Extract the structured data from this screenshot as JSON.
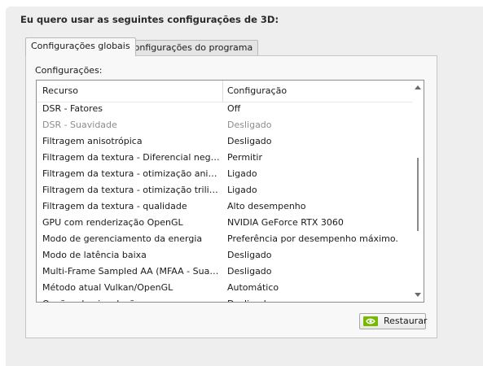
{
  "heading": "Eu quero usar as seguintes configurações de 3D:",
  "tabs": [
    {
      "label": "Configurações globais",
      "active": true
    },
    {
      "label": "Configurações do programa",
      "active": false
    }
  ],
  "settings_label": "Configurações:",
  "table": {
    "columns": [
      "Recurso",
      "Configuração"
    ],
    "rows": [
      {
        "feature": "DSR - Fatores",
        "value": "Off",
        "enabled": true
      },
      {
        "feature": "DSR - Suavidade",
        "value": "Desligado",
        "enabled": false
      },
      {
        "feature": "Filtragem anisotrópica",
        "value": "Desligado",
        "enabled": true
      },
      {
        "feature": "Filtragem da textura - Diferencial negativo...",
        "value": "Permitir",
        "enabled": true
      },
      {
        "feature": "Filtragem da textura - otimização anisotró...",
        "value": "Ligado",
        "enabled": true
      },
      {
        "feature": "Filtragem da textura - otimização trilinear",
        "value": "Ligado",
        "enabled": true
      },
      {
        "feature": "Filtragem da textura - qualidade",
        "value": "Alto desempenho",
        "enabled": true
      },
      {
        "feature": "GPU com renderização OpenGL",
        "value": "NVIDIA GeForce RTX 3060",
        "enabled": true
      },
      {
        "feature": "Modo de gerenciamento da energia",
        "value": "Preferência por desempenho máximo.",
        "enabled": true
      },
      {
        "feature": "Modo de latência baixa",
        "value": "Desligado",
        "enabled": true
      },
      {
        "feature": "Multi-Frame Sampled AA (MFAA - Suavizaç...",
        "value": "Desligado",
        "enabled": true
      },
      {
        "feature": "Método atual Vulkan/OpenGL",
        "value": "Automático",
        "enabled": true
      },
      {
        "feature": "Opções de vinculação",
        "value": "Desligado",
        "enabled": true
      }
    ]
  },
  "restore_button": {
    "label": "Restaurar",
    "icon": "nvidia-logo-icon"
  },
  "colors": {
    "nvidia_green": "#76b900"
  }
}
